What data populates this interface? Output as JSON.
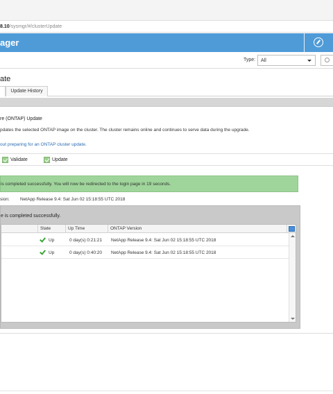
{
  "browser": {
    "url_host": "8.10",
    "url_path": "/sysmgr/#/clusterUpdate"
  },
  "app": {
    "title": "ager"
  },
  "toolbar": {
    "type_label": "Type:",
    "type_value": "All"
  },
  "page": {
    "title": "ate"
  },
  "tabs": [
    {
      "label": ""
    },
    {
      "label": "Update History"
    }
  ],
  "step": {
    "title": "re (ONTAP) Update",
    "description": "pdates the selected ONTAP image on the cluster. The cluster remains online and continues to serve data during the upgrade.",
    "link": "out preparing for an ONTAP cluster update."
  },
  "steps": [
    {
      "label": "Validate"
    },
    {
      "label": "Update"
    }
  ],
  "success_message": "is completed successfully. You will now be redirected to the login page in 19 seconds.",
  "version": {
    "label": "sion:",
    "value": "NetApp Release 9.4: Sat Jun 02 15:18:55 UTC 2018"
  },
  "panel": {
    "message": "e is completed successfully."
  },
  "grid": {
    "columns": [
      "State",
      "Up Time",
      "ONTAP Version"
    ],
    "rows": [
      {
        "state": "Up",
        "uptime": "0 day(s) 0:21:21",
        "version": "NetApp Release 9.4: Sat Jun 02 15:18:55 UTC 2018"
      },
      {
        "state": "Up",
        "uptime": "0 day(s) 0:40:20",
        "version": "NetApp Release 9.4: Sat Jun 02 15:18:55 UTC 2018"
      }
    ]
  },
  "colors": {
    "banner": "#4f9bd8",
    "success": "#9fd59b",
    "check": "#3aa639"
  }
}
